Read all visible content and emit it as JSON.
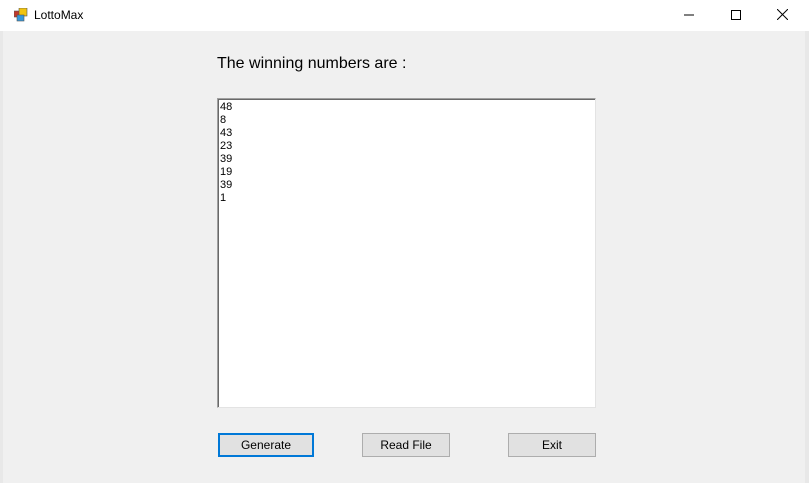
{
  "window": {
    "title": "LottoMax",
    "minimize_icon": "minimize-icon",
    "maximize_icon": "maximize-icon",
    "close_icon": "close-icon"
  },
  "main": {
    "heading": "The winning numbers are :",
    "numbers": [
      "48",
      "8",
      "43",
      "23",
      "39",
      "19",
      "39",
      "1"
    ]
  },
  "buttons": {
    "generate_label": "Generate",
    "read_file_label": "Read File",
    "exit_label": "Exit"
  },
  "colors": {
    "focus_accent": "#0078d7",
    "window_bg": "#f0f0f0"
  }
}
